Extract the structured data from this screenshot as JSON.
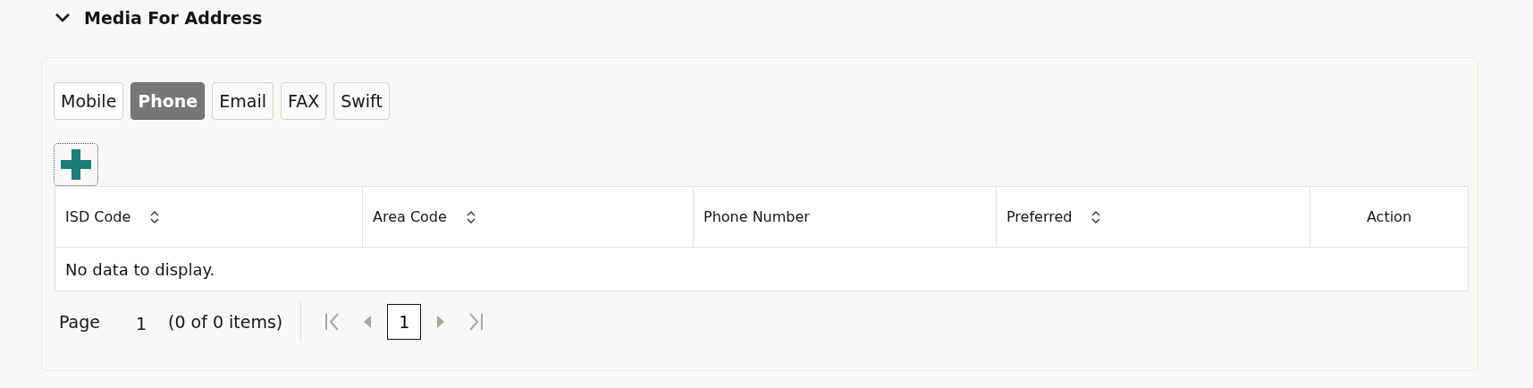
{
  "section": {
    "title": "Media For Address",
    "expanded": true
  },
  "tabs": [
    {
      "label": "Mobile",
      "selected": false
    },
    {
      "label": "Phone",
      "selected": true
    },
    {
      "label": "Email",
      "selected": false
    },
    {
      "label": "FAX",
      "selected": false
    },
    {
      "label": "Swift",
      "selected": false
    }
  ],
  "table": {
    "columns": [
      {
        "label": "ISD Code",
        "sortable": true,
        "kind": "data"
      },
      {
        "label": "Area Code",
        "sortable": true,
        "kind": "data"
      },
      {
        "label": "Phone Number",
        "sortable": false,
        "kind": "data"
      },
      {
        "label": "Preferred",
        "sortable": true,
        "kind": "data"
      },
      {
        "label": "Action",
        "sortable": false,
        "kind": "action"
      }
    ],
    "empty_message": "No data to display."
  },
  "pagination": {
    "page_label": "Page",
    "page_value": "1",
    "summary": "(0 of 0 items)",
    "nav": [
      {
        "kind": "first",
        "disabled": true
      },
      {
        "kind": "prev",
        "disabled": true
      },
      {
        "kind": "page",
        "label": "1",
        "selected": true
      },
      {
        "kind": "next",
        "disabled": true
      },
      {
        "kind": "last",
        "disabled": true
      }
    ]
  }
}
